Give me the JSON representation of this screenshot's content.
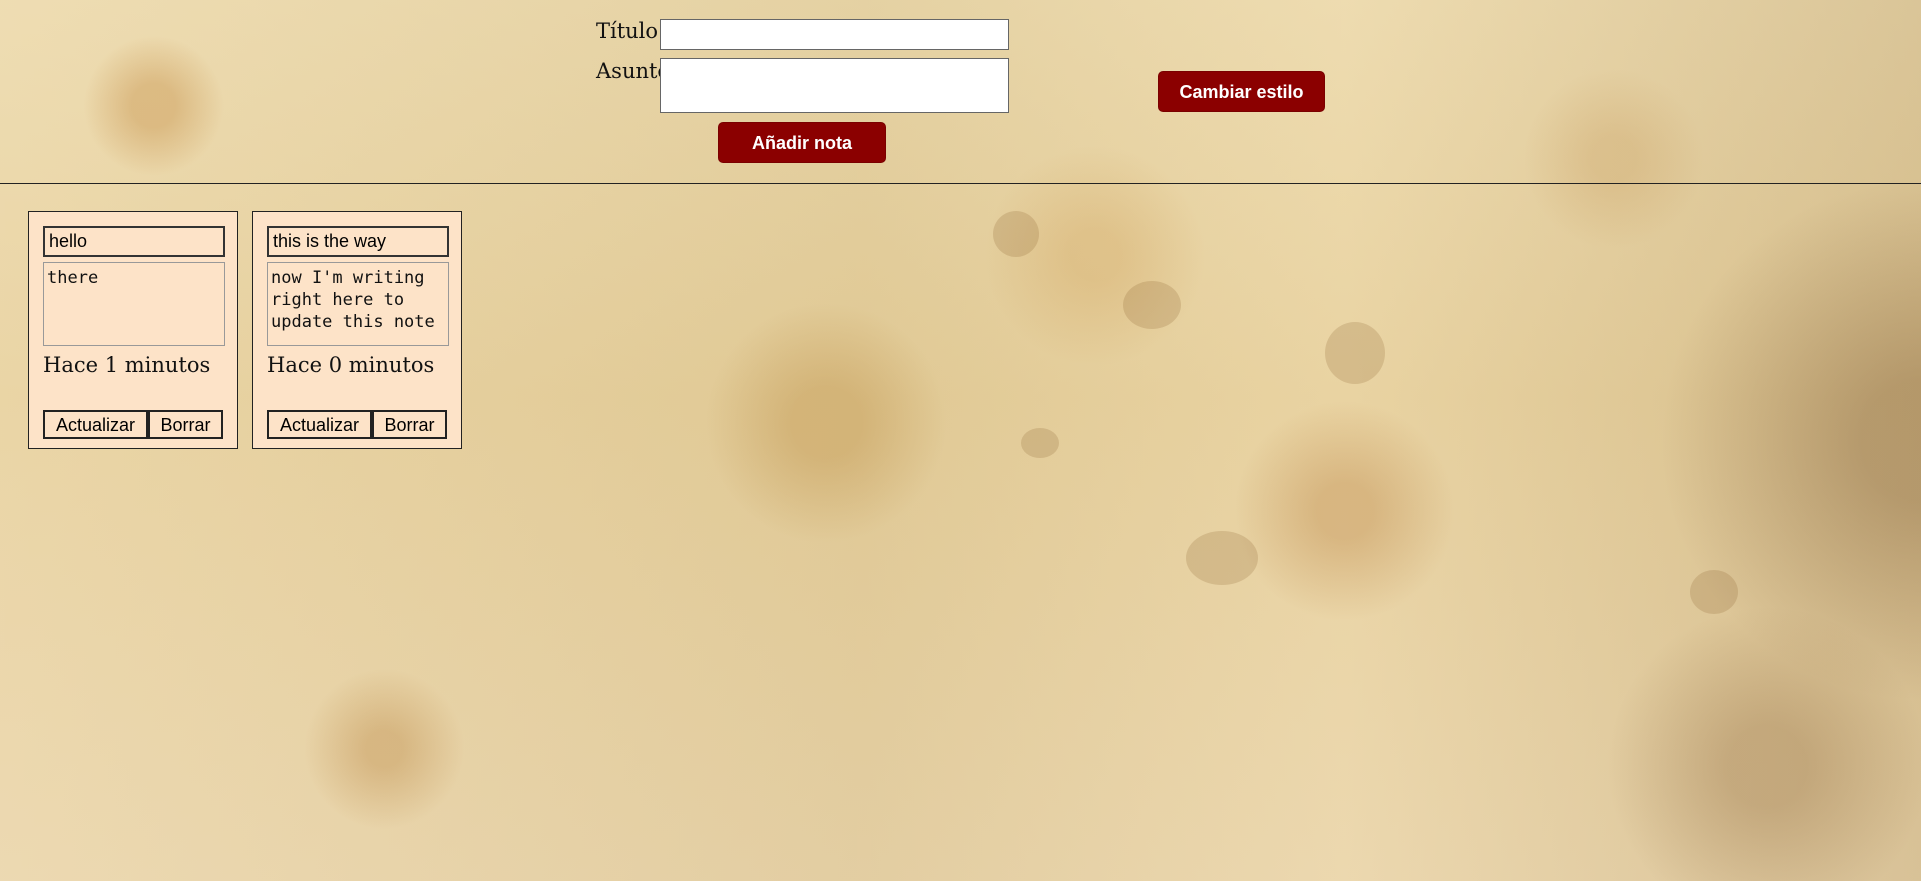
{
  "form": {
    "title_label": "Título",
    "title_value": "",
    "subject_label": "Asunto",
    "subject_value": "",
    "add_button": "Añadir nota",
    "style_button": "Cambiar estilo"
  },
  "notes": [
    {
      "title": "hello",
      "body": "there",
      "time": "Hace 1 minutos",
      "update_button": "Actualizar",
      "delete_button": "Borrar"
    },
    {
      "title": "this is the way",
      "body": "now I'm writing right here to update this note",
      "time": "Hace 0 minutos",
      "update_button": "Actualizar",
      "delete_button": "Borrar"
    }
  ],
  "colors": {
    "paper": "#e8d2a1",
    "button": "#8b0000",
    "note_background": "#fde3c8",
    "border": "#222222"
  }
}
